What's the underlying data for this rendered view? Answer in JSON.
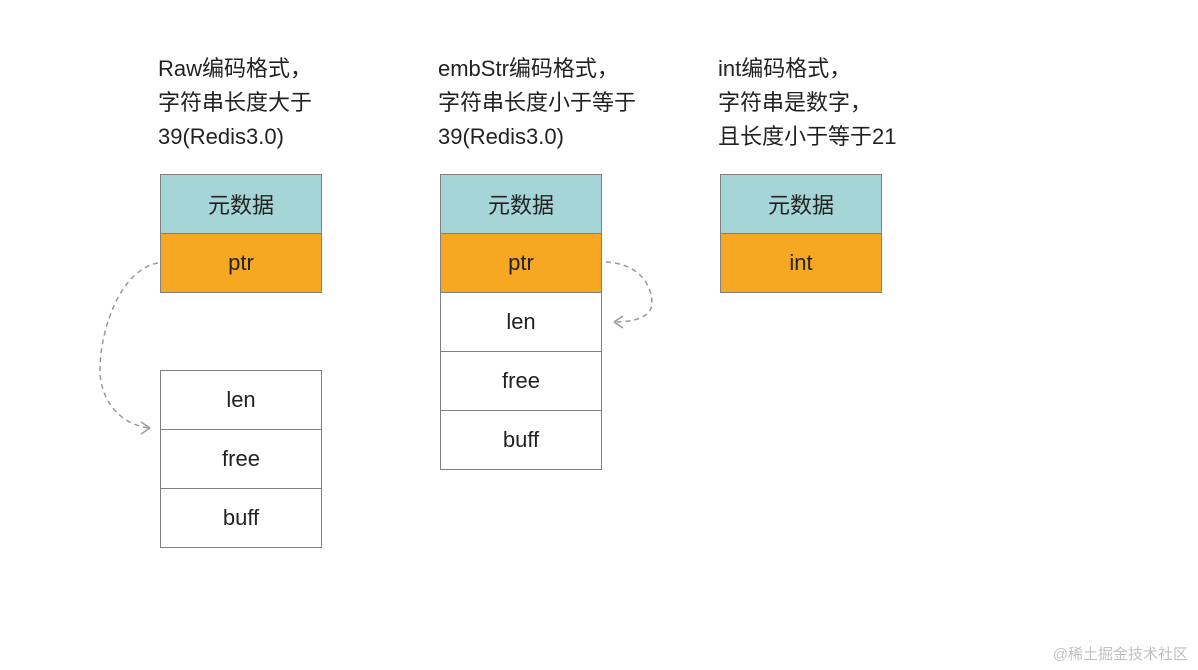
{
  "columns": {
    "raw": {
      "desc_line1": "Raw编码格式，",
      "desc_line2": "字符串长度大于",
      "desc_line3": "39(Redis3.0)",
      "meta": "元数据",
      "ptr": "ptr",
      "len": "len",
      "free": "free",
      "buff": "buff"
    },
    "embstr": {
      "desc_line1": "embStr编码格式，",
      "desc_line2": "字符串长度小于等于",
      "desc_line3": "39(Redis3.0)",
      "meta": "元数据",
      "ptr": "ptr",
      "len": "len",
      "free": "free",
      "buff": "buff"
    },
    "int": {
      "desc_line1": "int编码格式，",
      "desc_line2": "字符串是数字，",
      "desc_line3": "且长度小于等于21",
      "meta": "元数据",
      "int": "int"
    }
  },
  "watermark": "@稀土掘金技术社区",
  "colors": {
    "teal": "#a6d5d7",
    "orange": "#f7a823",
    "border": "#808080"
  }
}
